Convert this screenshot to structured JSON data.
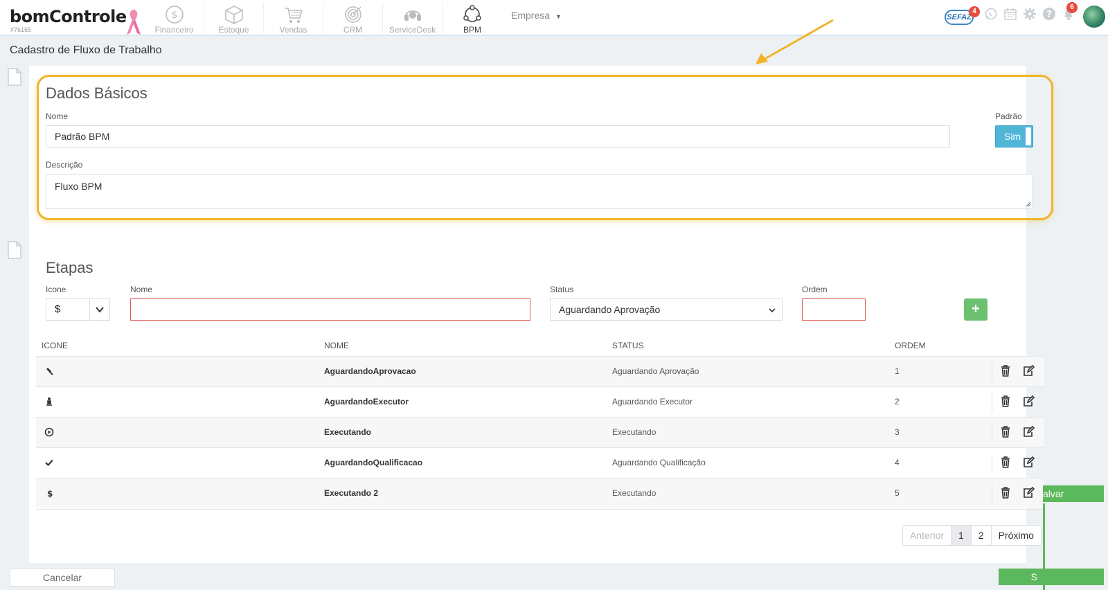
{
  "brand": {
    "name": "bomControle",
    "account": "#76165"
  },
  "nav": {
    "items": [
      {
        "label": "Financeiro"
      },
      {
        "label": "Estoque"
      },
      {
        "label": "Vendas"
      },
      {
        "label": "CRM"
      },
      {
        "label": "ServiceDesk"
      },
      {
        "label": "BPM"
      }
    ],
    "empresa": "Empresa",
    "sefaz_label": "SEFAZ",
    "sefaz_badge": "4",
    "notifications_badge": "6"
  },
  "page": {
    "title": "Cadastro de Fluxo de Trabalho"
  },
  "dados_basicos": {
    "title": "Dados Básicos",
    "nome_label": "Nome",
    "nome_value": "Padrão BPM",
    "padrao_label": "Padrão",
    "padrao_value": "Sim",
    "descricao_label": "Descrição",
    "descricao_value": "Fluxo BPM"
  },
  "etapas": {
    "title": "Etapas",
    "icone_label": "Icone",
    "icone_value": "$",
    "nome_label": "Nome",
    "nome_value": "",
    "status_label": "Status",
    "status_value": "Aguardando Aprovação",
    "ordem_label": "Ordem",
    "ordem_value": "",
    "add_label": "+",
    "columns": {
      "icone": "ICONE",
      "nome": "NOME",
      "status": "STATUS",
      "ordem": "ORDEM"
    },
    "rows": [
      {
        "icon": "gavel-icon",
        "nome": "AguardandoAprovacao",
        "status": "Aguardando Aprovação",
        "ordem": "1"
      },
      {
        "icon": "person-icon",
        "nome": "AguardandoExecutor",
        "status": "Aguardando Executor",
        "ordem": "2"
      },
      {
        "icon": "play-circle-icon",
        "nome": "Executando",
        "status": "Executando",
        "ordem": "3"
      },
      {
        "icon": "check-icon",
        "nome": "AguardandoQualificacao",
        "status": "Aguardando Qualificação",
        "ordem": "4"
      },
      {
        "icon": "dollar-icon",
        "nome": "Executando 2",
        "status": "Executando",
        "ordem": "5"
      }
    ]
  },
  "pagination": {
    "prev": "Anterior",
    "pages": [
      "1",
      "2"
    ],
    "next": "Próximo",
    "current": "1"
  },
  "footer": {
    "cancel": "Cancelar",
    "save_partial": "alvar",
    "save_bottom_partial": "S"
  },
  "colors": {
    "accent": "#4fb6d8",
    "success": "#5cb85c",
    "highlight": "#f0b429",
    "error": "#e05a52"
  }
}
